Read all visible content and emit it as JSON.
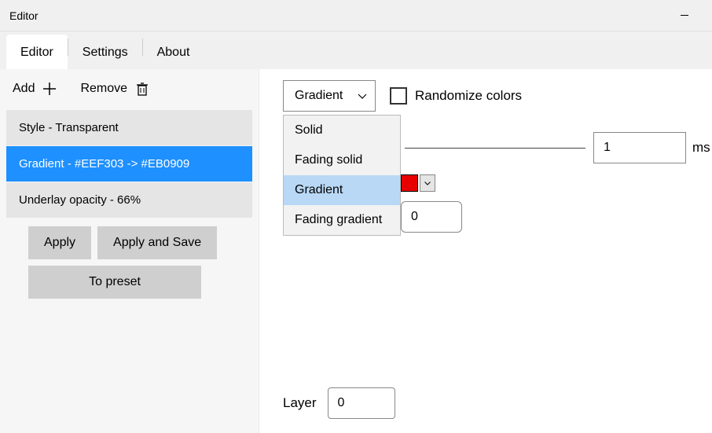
{
  "window": {
    "title": "Editor"
  },
  "tabs": [
    {
      "label": "Editor",
      "active": true
    },
    {
      "label": "Settings",
      "active": false
    },
    {
      "label": "About",
      "active": false
    }
  ],
  "sidebar": {
    "add_label": "Add",
    "remove_label": "Remove",
    "items": [
      {
        "label": "Style - Transparent",
        "selected": false
      },
      {
        "label": "Gradient - #EEF303 -> #EB0909",
        "selected": true
      },
      {
        "label": "Underlay opacity - 66%",
        "selected": false
      }
    ],
    "apply_label": "Apply",
    "apply_save_label": "Apply and Save",
    "to_preset_label": "To preset"
  },
  "main": {
    "type_selected": "Gradient",
    "type_options": [
      "Solid",
      "Fading solid",
      "Gradient",
      "Fading gradient"
    ],
    "randomize_label": "Randomize colors",
    "randomize_checked": false,
    "time_value": "1",
    "time_unit": "ms",
    "color_swatch": "#e60000",
    "number_value": "0",
    "layer_label": "Layer",
    "layer_value": "0"
  }
}
